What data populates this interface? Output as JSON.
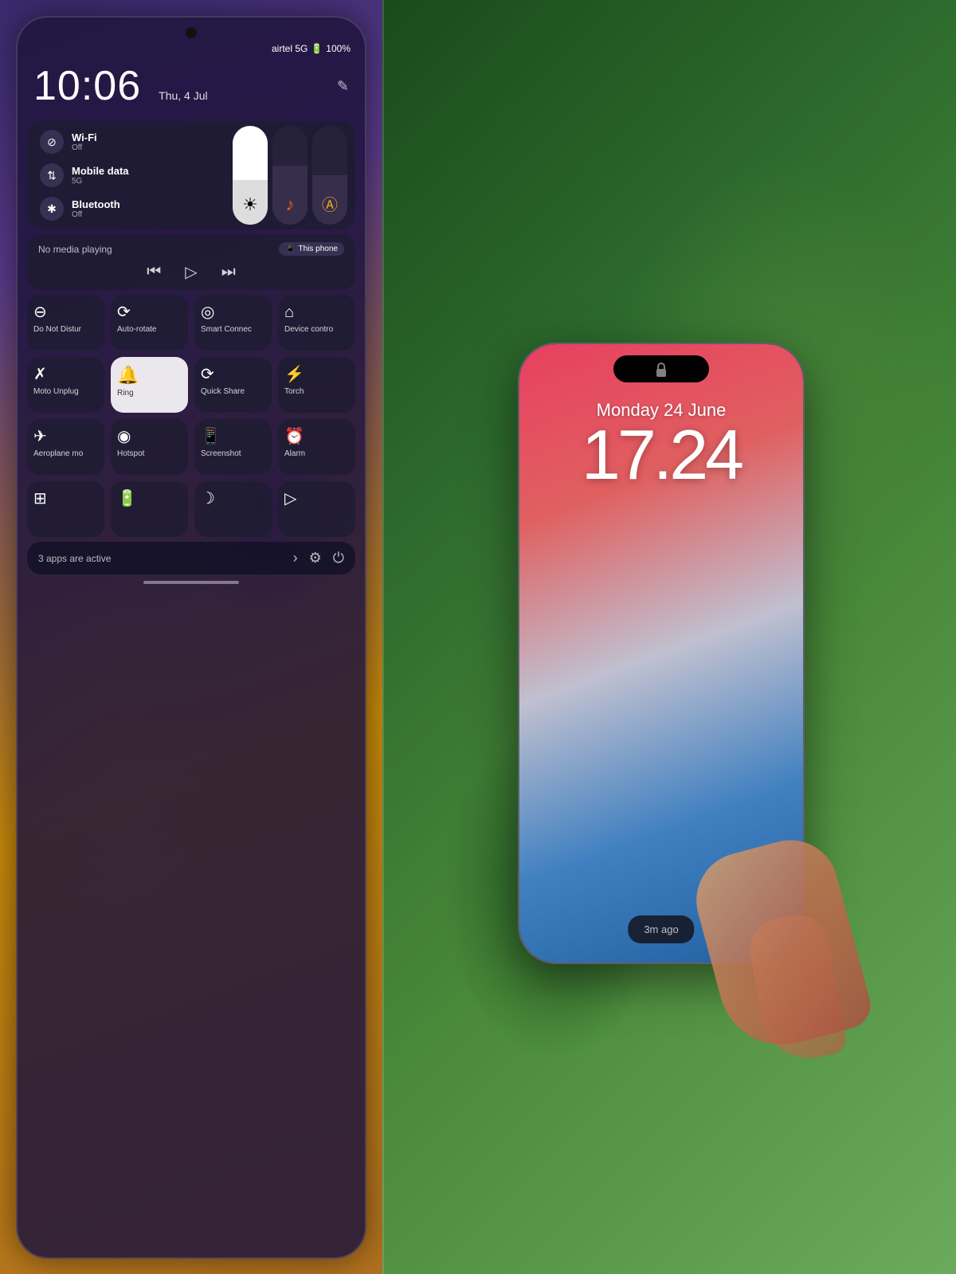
{
  "left": {
    "status": {
      "carrier": "airtel 5G",
      "battery": "100%"
    },
    "clock": {
      "time": "10:06",
      "date": "Thu, 4 Jul"
    },
    "connectivity": {
      "wifi": {
        "label": "Wi-Fi",
        "sub": "Off",
        "icon": "⊘"
      },
      "mobile": {
        "label": "Mobile data",
        "sub": "5G",
        "icon": "⇅"
      },
      "bluetooth": {
        "label": "Bluetooth",
        "sub": "Off",
        "icon": "✱"
      }
    },
    "media": {
      "status": "No media playing",
      "device": "This phone"
    },
    "tiles": [
      {
        "icon": "⊖",
        "label": "Do Not Distur",
        "active": false
      },
      {
        "icon": "⟳",
        "label": "Auto-rotate",
        "active": false
      },
      {
        "icon": "◎",
        "label": "Smart Connec",
        "active": false
      },
      {
        "icon": "⌂",
        "label": "Device contro",
        "active": false
      },
      {
        "icon": "✗",
        "label": "Moto Unplug",
        "active": false
      },
      {
        "icon": "🔔",
        "label": "Ring",
        "active": true
      },
      {
        "icon": "⟳",
        "label": "Quick Share",
        "active": false
      },
      {
        "icon": "⚡",
        "label": "Torch",
        "active": false
      },
      {
        "icon": "✈",
        "label": "Aeroplane mo",
        "active": false
      },
      {
        "icon": "◉",
        "label": "Hotspot",
        "active": false
      },
      {
        "icon": "📱",
        "label": "Screenshot",
        "active": false
      },
      {
        "icon": "⏰",
        "label": "Alarm",
        "active": false
      },
      {
        "icon": "⊞",
        "label": "",
        "active": false
      },
      {
        "icon": "🔋",
        "label": "",
        "active": false
      },
      {
        "icon": "☽",
        "label": "",
        "active": false
      },
      {
        "icon": "▷",
        "label": "",
        "active": false
      }
    ],
    "bottom": {
      "active_apps": "3 apps are active",
      "arrow": "›"
    }
  },
  "right": {
    "date": "Monday 24 June",
    "time": "17.24",
    "notification": "3m ago"
  }
}
